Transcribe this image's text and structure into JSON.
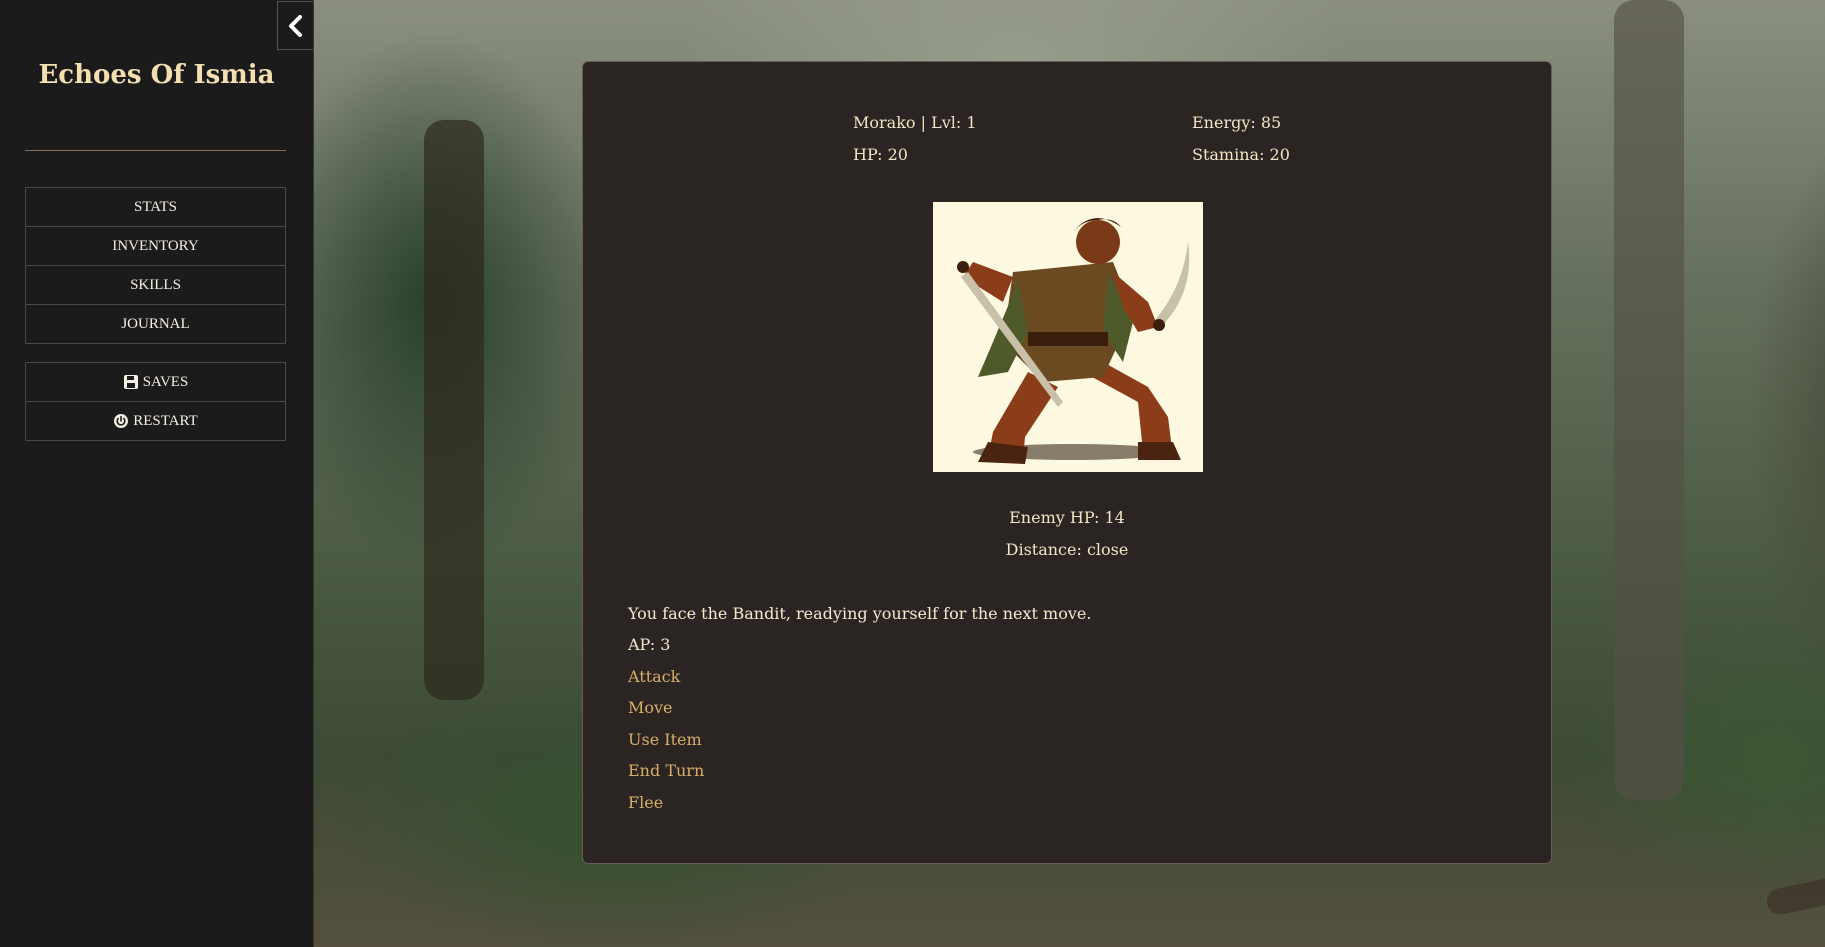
{
  "app": {
    "title": "Echoes Of Ismia"
  },
  "sidebar": {
    "menu": [
      {
        "label": "STATS"
      },
      {
        "label": "INVENTORY"
      },
      {
        "label": "SKILLS"
      },
      {
        "label": "JOURNAL"
      }
    ],
    "system": [
      {
        "label": "SAVES",
        "icon": "save-icon"
      },
      {
        "label": "RESTART",
        "icon": "power-icon"
      }
    ],
    "collapse_icon": "chevron-left-icon"
  },
  "player": {
    "name_level": "Morako | Lvl: 1",
    "hp": "HP: 20",
    "energy": "Energy: 85",
    "stamina": "Stamina: 20"
  },
  "enemy": {
    "portrait_icon": "bandit-portrait",
    "hp": "Enemy HP: 14",
    "distance": "Distance: close"
  },
  "combat": {
    "message": "You face the Bandit, readying yourself for the next move.",
    "ap": "AP: 3",
    "actions": [
      "Attack",
      "Move",
      "Use Item",
      "End Turn",
      "Flee"
    ]
  },
  "colors": {
    "sidebar_bg": "#1c1b1b",
    "panel_bg": "#2a2523",
    "action_link": "#d9ad67",
    "title": "#f5dfb0"
  }
}
